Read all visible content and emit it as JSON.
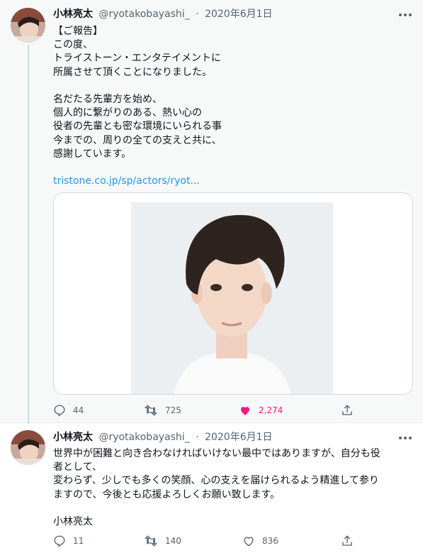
{
  "tweets": [
    {
      "author_name": "小林亮太",
      "handle": "@ryotakobayashi_",
      "separator": "·",
      "date": "2020年6月1日",
      "text_lines": [
        "【ご報告】",
        "この度、",
        "トライストーン・エンタテイメントに",
        "所属させて頂くことになりました。",
        "",
        "名だたる先輩方を始め、",
        "個人的に繋がりのある、熱い心の",
        "役者の先輩とも密な環境にいられる事",
        "今までの、周りの全ての支えと共に、",
        "感謝しています。",
        ""
      ],
      "link": "tristone.co.jp/sp/actors/ryot...",
      "actions": {
        "reply_count": "44",
        "retweet_count": "725",
        "like_count": "2,274"
      }
    },
    {
      "author_name": "小林亮太",
      "handle": "@ryotakobayashi_",
      "separator": "·",
      "date": "2020年6月1日",
      "text_lines": [
        "世界中が困難と向き合わなければいけない最中ではありますが、自分も役",
        "者として、",
        "変わらず、少しでも多くの笑顔、心の支えを届けられるよう精進して参り",
        "ますので、今後とも応援よろしくお願い致します。",
        "",
        "小林亮太"
      ],
      "actions": {
        "reply_count": "11",
        "retweet_count": "140",
        "like_count": "836"
      }
    }
  ],
  "colors": {
    "link": "#1d9bf0",
    "secondary_text": "#536471",
    "like_active": "#f91880",
    "highlight_bg": "#f7f9f9"
  }
}
